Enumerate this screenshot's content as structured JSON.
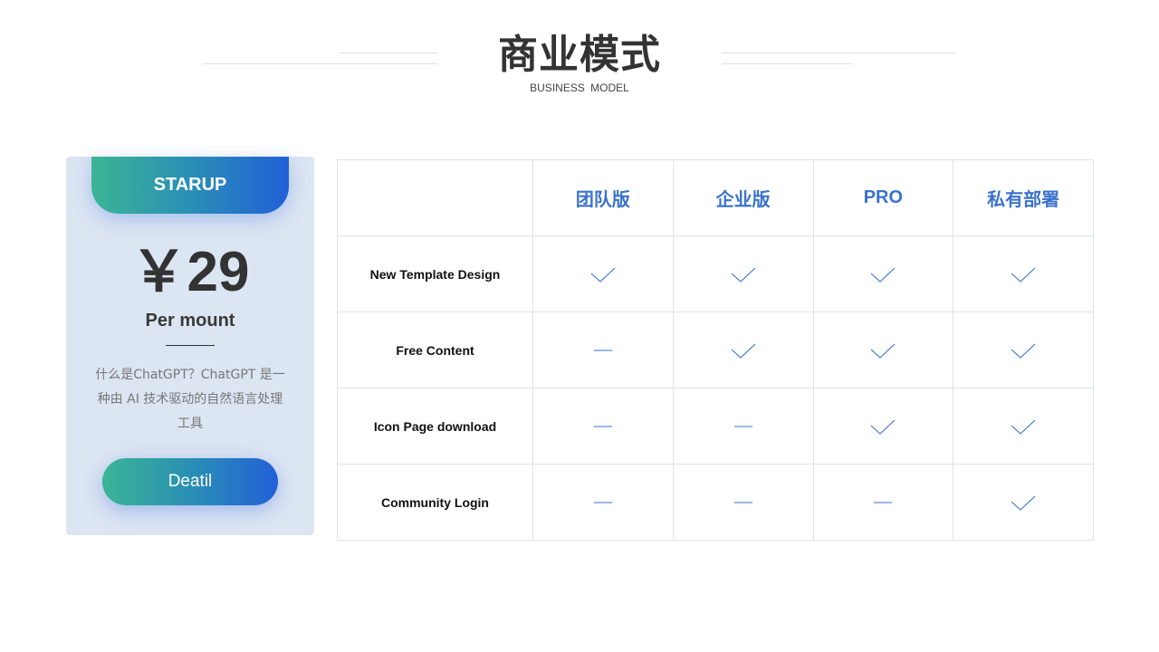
{
  "header": {
    "title": "商业模式",
    "subtitle": "BUSINESS MODEL"
  },
  "plan_card": {
    "ribbon_label": "STARUP",
    "price": "￥29",
    "period": "Per mount",
    "description": "什么是ChatGPT？ChatGPT 是一种由 AI 技术驱动的自然语言处理工具",
    "button_label": "Deatil"
  },
  "comparison": {
    "columns": [
      "",
      "团队版",
      "企业版",
      "PRO",
      "私有部署"
    ],
    "rows": [
      {
        "feature": "New Template Design",
        "values": [
          "check",
          "check",
          "check",
          "check"
        ]
      },
      {
        "feature": "Free Content",
        "values": [
          "dash",
          "check",
          "check",
          "check"
        ]
      },
      {
        "feature": "Icon Page download",
        "values": [
          "dash",
          "dash",
          "check",
          "check"
        ]
      },
      {
        "feature": "Community Login",
        "values": [
          "dash",
          "dash",
          "dash",
          "check"
        ]
      }
    ]
  },
  "colors": {
    "accent_blue": "#3a72cc",
    "gradient_start": "#3bb595",
    "gradient_end": "#2260d8",
    "card_bg": "#dce5f2"
  }
}
